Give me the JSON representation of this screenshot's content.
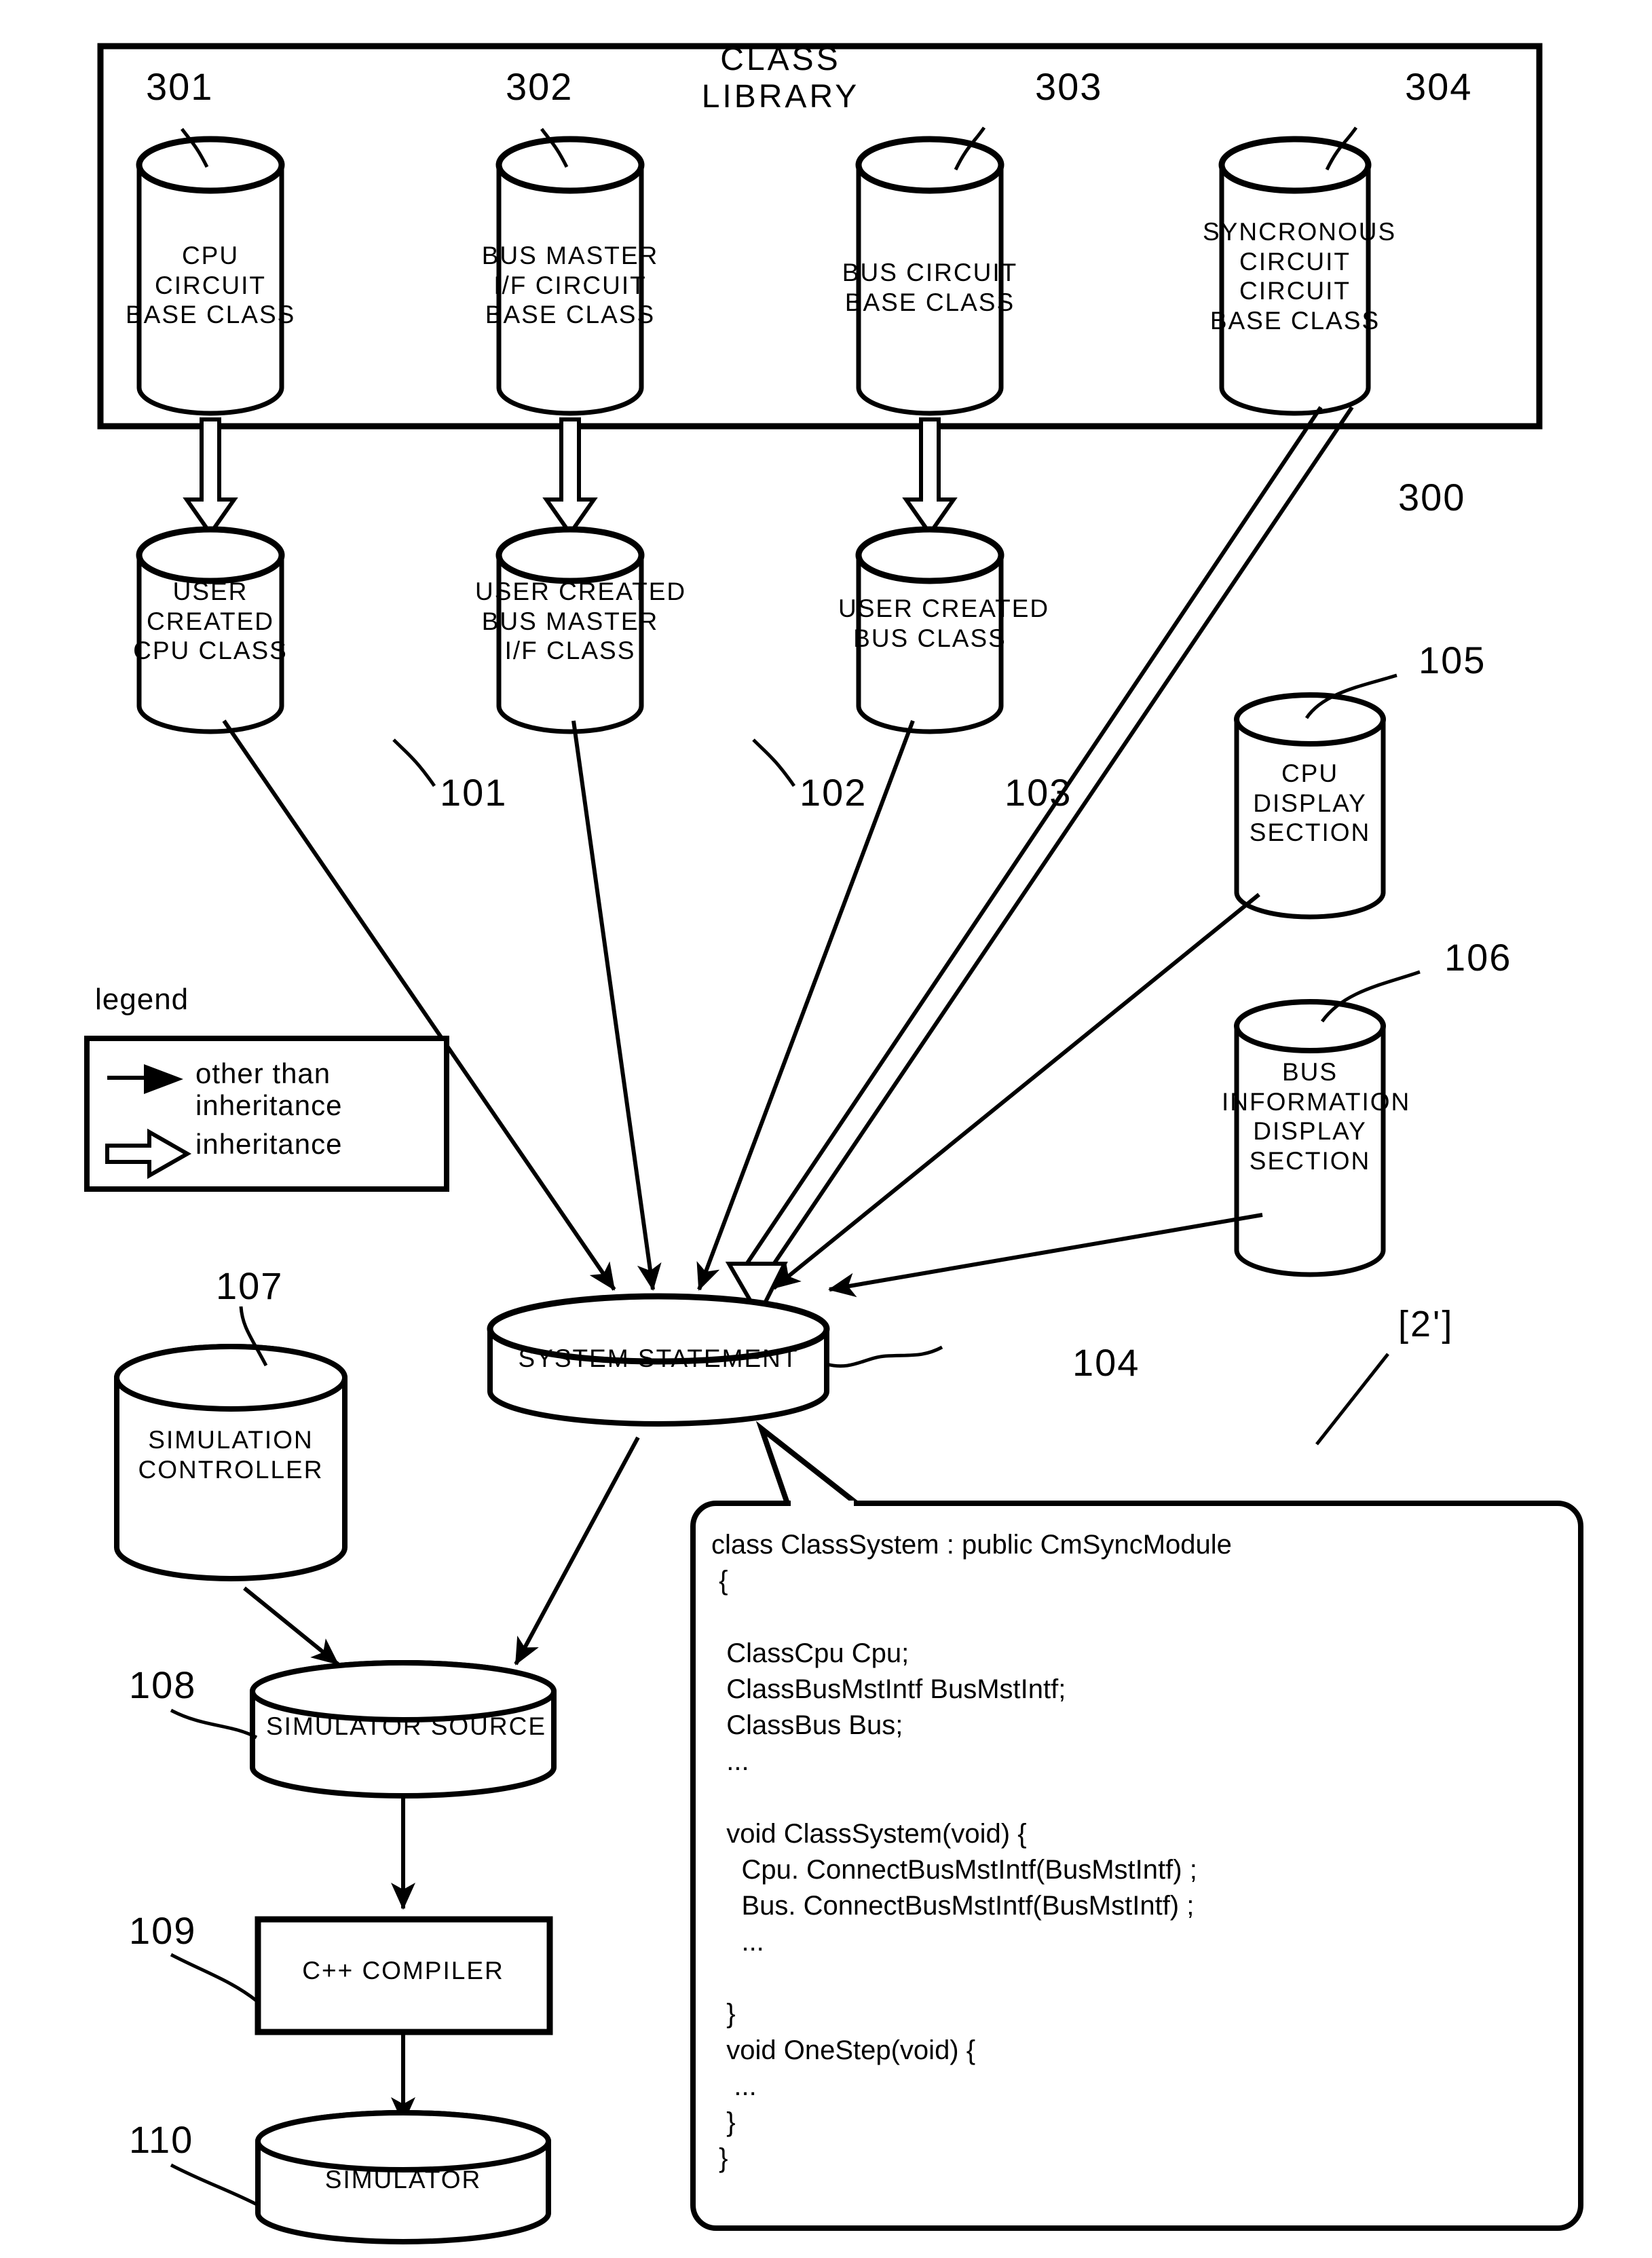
{
  "figure": {
    "class_library_title": "CLASS LIBRARY",
    "class_library_ref": "300",
    "variant_tag": "[2']"
  },
  "base_classes": [
    {
      "ref": "301",
      "label": "CPU\nCIRCUIT\nBASE CLASS"
    },
    {
      "ref": "302",
      "label": "BUS MASTER\nI/F CIRCUIT\nBASE CLASS"
    },
    {
      "ref": "303",
      "label": "BUS CIRCUIT\nBASE CLASS"
    },
    {
      "ref": "304",
      "label": "SYNCRONOUS\nCIRCUIT\nCIRCUIT\nBASE CLASS"
    }
  ],
  "user_classes": [
    {
      "ref": "101",
      "label": "USER\nCREATED\nCPU CLASS"
    },
    {
      "ref": "102",
      "label": "USER CREATED\nBUS MASTER\nI/F CLASS"
    },
    {
      "ref": "103",
      "label": "USER CREATED\nBUS CLASS"
    }
  ],
  "display_sections": [
    {
      "ref": "105",
      "label": "CPU\nDISPLAY\nSECTION"
    },
    {
      "ref": "106",
      "label": "BUS\nINFORMATION\nDISPLAY\nSECTION"
    }
  ],
  "system": {
    "ref": "104",
    "label": "SYSTEM STATEMENT"
  },
  "pipeline": [
    {
      "ref": "107",
      "label": "SIMULATION\nCONTROLLER",
      "shape": "cylinder"
    },
    {
      "ref": "108",
      "label": "SIMULATOR SOURCE",
      "shape": "cylinder-flat"
    },
    {
      "ref": "109",
      "label": "C++ COMPILER",
      "shape": "rect"
    },
    {
      "ref": "110",
      "label": "SIMULATOR",
      "shape": "cylinder-flat"
    }
  ],
  "legend": {
    "title": "legend",
    "entries": [
      {
        "arrow": "solid-arrow-icon",
        "text": "other than\ninheritance"
      },
      {
        "arrow": "hollow-arrow-icon",
        "text": "inheritance"
      }
    ]
  },
  "code_box": {
    "lines": [
      "class ClassSystem : public CmSyncModule",
      " {",
      "",
      "  ClassCpu Cpu;",
      "  ClassBusMstIntf BusMstIntf;",
      "  ClassBus Bus;",
      "  ...",
      "",
      "  void ClassSystem(void) {",
      "    Cpu. ConnectBusMstIntf(BusMstIntf) ;",
      "    Bus. ConnectBusMstIntf(BusMstIntf) ;",
      "    ...",
      "",
      "  }",
      "  void OneStep(void) {",
      "   ...",
      "  }",
      " }"
    ]
  },
  "colors": {
    "ink": "#000000",
    "paper": "#ffffff"
  }
}
